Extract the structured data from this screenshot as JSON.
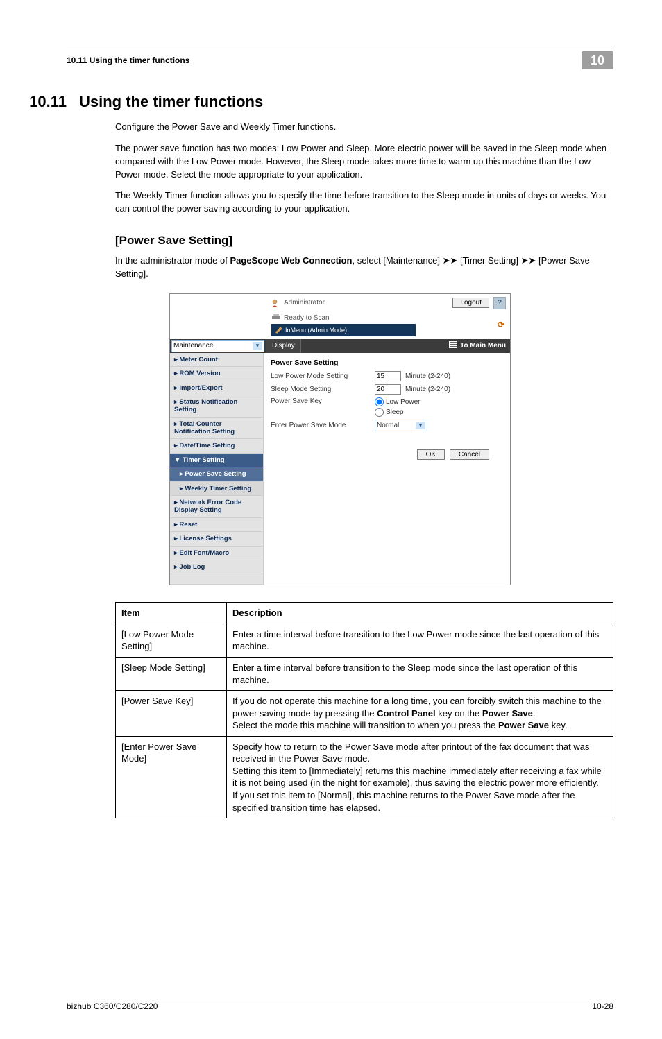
{
  "header": {
    "section_ref": "10.11    Using the timer functions",
    "chapter_box": "10"
  },
  "heading": {
    "num": "10.11",
    "title": "Using the timer functions"
  },
  "paras": {
    "p1": "Configure the Power Save and Weekly Timer functions.",
    "p2": "The power save function has two modes: Low Power and Sleep. More electric power will be saved in the Sleep mode when compared with the Low Power mode. However, the Sleep mode takes more time to warm up this machine than the Low Power mode. Select the mode appropriate to your application.",
    "p3": "The Weekly Timer function allows you to specify the time before transition to the Sleep mode in units of days or weeks. You can control the power saving according to your application."
  },
  "subhead": "[Power Save Setting]",
  "lead_in": {
    "pre": "In the administrator mode of ",
    "bold1": "PageScope Web Connection",
    "post": ", select [Maintenance] ➤➤ [Timer Setting] ➤➤ [Power Save Setting]."
  },
  "screenshot": {
    "user_role": "Administrator",
    "logout": "Logout",
    "help": "?",
    "ready": "Ready to Scan",
    "status_banner": "InMenu (Admin Mode)",
    "refresh_glyph": "⟳",
    "dropdown_category": "Maintenance",
    "display_btn": "Display",
    "to_main_menu": "To Main Menu",
    "nav": {
      "meter_count": "Meter Count",
      "rom_version": "ROM Version",
      "import_export": "Import/Export",
      "status_notification": "Status Notification Setting",
      "total_counter": "Total Counter Notification Setting",
      "datetime": "Date/Time Setting",
      "timer_setting": "Timer Setting",
      "power_save_setting": "Power Save Setting",
      "weekly_timer": "Weekly Timer Setting",
      "network_error": "Network Error Code Display Setting",
      "reset": "Reset",
      "license": "License Settings",
      "edit_font": "Edit Font/Macro",
      "job_log": "Job Log"
    },
    "form": {
      "title": "Power Save Setting",
      "low_power_label": "Low Power Mode Setting",
      "low_power_value": "15",
      "low_power_unit": "Minute (2-240)",
      "sleep_label": "Sleep Mode Setting",
      "sleep_value": "20",
      "sleep_unit": "Minute (2-240)",
      "psk_label": "Power Save Key",
      "psk_opt1": "Low Power",
      "psk_opt2": "Sleep",
      "epsm_label": "Enter Power Save Mode",
      "epsm_value": "Normal",
      "ok": "OK",
      "cancel": "Cancel"
    }
  },
  "table": {
    "head_item": "Item",
    "head_desc": "Description",
    "rows": [
      {
        "item": "[Low Power Mode Setting]",
        "desc": "Enter a time interval before transition to the Low Power mode since the last operation of this machine."
      },
      {
        "item": "[Sleep Mode Setting]",
        "desc": "Enter a time interval before transition to the Sleep mode since the last operation of this machine."
      },
      {
        "item": "[Power Save Key]",
        "desc_pre": "If you do not operate this machine for a long time, you can forcibly switch this machine to the power saving mode by pressing the ",
        "bold1": "Control Panel",
        "desc_mid1": " key on the ",
        "bold2": "Power Save",
        "desc_mid2": ".\nSelect the mode this machine will transition to when you press the ",
        "bold3": "Power Save",
        "desc_post": " key."
      },
      {
        "item": "[Enter Power Save Mode]",
        "desc": "Specify how to return to the Power Save mode after printout of the fax document that was received in the Power Save mode.\nSetting this item to [Immediately] returns this machine immediately after receiving a fax while it is not being used (in the night for example), thus saving the electric power more efficiently.\nIf you set this item to [Normal], this machine returns to the Power Save mode after the specified transition time has elapsed."
      }
    ]
  },
  "footer": {
    "left": "bizhub C360/C280/C220",
    "right": "10-28"
  },
  "chart_data": {
    "type": "table",
    "title": "Power Save Setting item descriptions",
    "columns": [
      "Item",
      "Description"
    ],
    "rows": [
      [
        "[Low Power Mode Setting]",
        "Enter a time interval before transition to the Low Power mode since the last operation of this machine."
      ],
      [
        "[Sleep Mode Setting]",
        "Enter a time interval before transition to the Sleep mode since the last operation of this machine."
      ],
      [
        "[Power Save Key]",
        "If you do not operate this machine for a long time, you can forcibly switch this machine to the power saving mode by pressing the Control Panel key on the Power Save. Select the mode this machine will transition to when you press the Power Save key."
      ],
      [
        "[Enter Power Save Mode]",
        "Specify how to return to the Power Save mode after printout of the fax document that was received in the Power Save mode. Setting this item to [Immediately] returns this machine immediately after receiving a fax while it is not being used (in the night for example), thus saving the electric power more efficiently. If you set this item to [Normal], this machine returns to the Power Save mode after the specified transition time has elapsed."
      ]
    ]
  }
}
